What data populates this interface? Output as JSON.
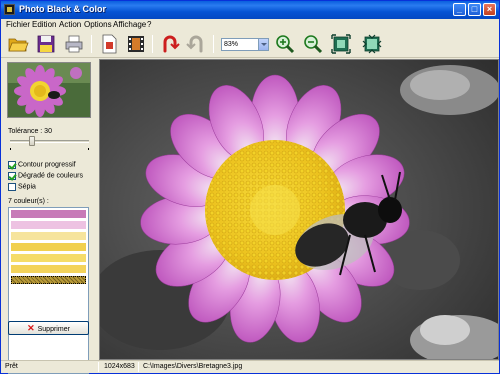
{
  "window": {
    "title": "Photo Black & Color"
  },
  "menu": [
    {
      "label": "Fichier"
    },
    {
      "label": "Edition"
    },
    {
      "label": "Action"
    },
    {
      "label": "Options"
    },
    {
      "label": "Affichage"
    },
    {
      "label": "?"
    }
  ],
  "toolbar": {
    "icons": [
      "open-folder-icon",
      "save-disk-icon",
      "print-icon",
      "new-document-icon",
      "film-strip-icon",
      "undo-icon",
      "redo-icon",
      "zoom-in-icon",
      "zoom-out-icon",
      "fit-to-window-icon",
      "actual-size-icon"
    ],
    "zoom_value": "83%"
  },
  "left_panel": {
    "tolerance_label": "Tolérance : 30",
    "tolerance_value": 30,
    "checkboxes": [
      {
        "label": "Contour progressif",
        "checked": true
      },
      {
        "label": "Dégradé de couleurs",
        "checked": true
      },
      {
        "label": "Sépia",
        "checked": false
      }
    ],
    "colors_label": "7 couleur(s) :",
    "colors": [
      "#c77ab8",
      "#edc2e2",
      "#f6e49c",
      "#f1d04e",
      "#f5dc68",
      "#f3d35a",
      "#b89a38"
    ],
    "selected_color_index": 6,
    "delete_button": "Supprimer"
  },
  "status": {
    "state": "Prêt",
    "dimensions": "1024x683",
    "path": "C:\\Images\\Divers\\Bretagne3.jpg"
  },
  "colors": {
    "title_bar": "#0a5fde",
    "window_bg": "#ece9d8",
    "petal_purple": "#c967c8",
    "flower_yellow": "#f2d431"
  }
}
